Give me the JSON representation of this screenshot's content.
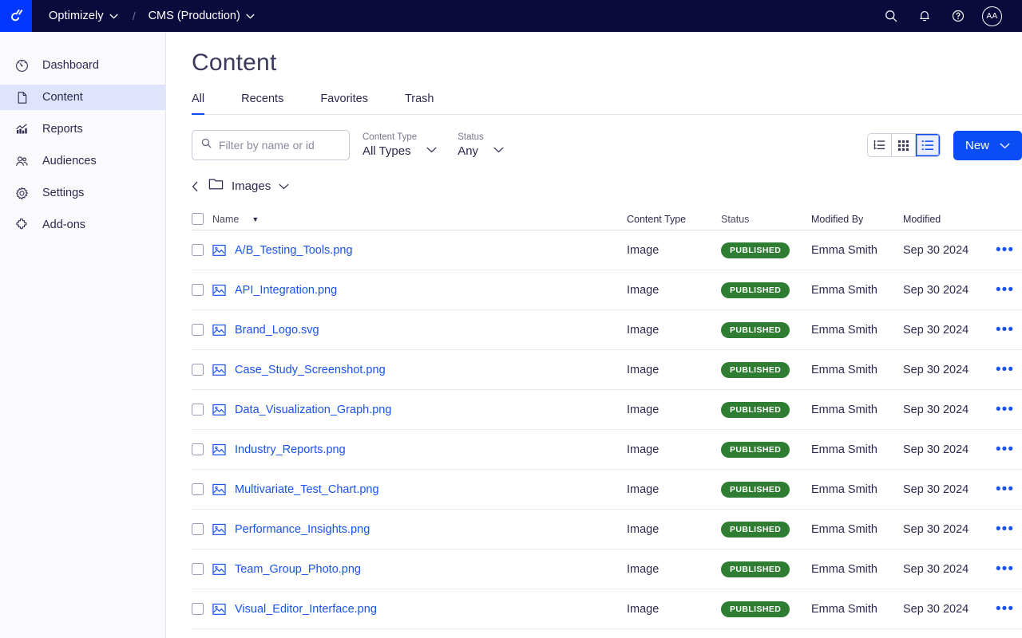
{
  "topbar": {
    "logo_icon": "optimizely-logo-icon",
    "brand": "Optimizely",
    "separator": "/",
    "environment": "CMS (Production)",
    "search_icon": "search-icon",
    "notifications_icon": "bell-icon",
    "help_icon": "help-circle-icon",
    "avatar_initials": "AA",
    "bg_color": "#0b0a3c",
    "logo_bg_color": "#0037ff"
  },
  "sidebar": {
    "items": [
      {
        "label": "Dashboard",
        "icon": "gauge-icon",
        "active": false
      },
      {
        "label": "Content",
        "icon": "document-icon",
        "active": true
      },
      {
        "label": "Reports",
        "icon": "chart-icon",
        "active": false
      },
      {
        "label": "Audiences",
        "icon": "people-icon",
        "active": false
      },
      {
        "label": "Settings",
        "icon": "gear-icon",
        "active": false
      },
      {
        "label": "Add-ons",
        "icon": "puzzle-icon",
        "active": false
      }
    ],
    "active_bg_color": "#dfe3fb"
  },
  "main": {
    "title": "Content",
    "tabs": [
      {
        "label": "All",
        "active": true
      },
      {
        "label": "Recents",
        "active": false
      },
      {
        "label": "Favorites",
        "active": false
      },
      {
        "label": "Trash",
        "active": false
      }
    ],
    "accent_color": "#0f4bf5",
    "search": {
      "value": "",
      "placeholder": "Filter by name or id",
      "icon": "search-icon"
    },
    "filters": [
      {
        "label": "Content Type",
        "value": "All Types",
        "icon": "chevron-down-icon"
      },
      {
        "label": "Status",
        "value": "Any",
        "icon": "chevron-down-icon"
      }
    ],
    "view_modes": [
      {
        "name": "tree-view",
        "icon": "tree-list-icon",
        "active": false
      },
      {
        "name": "grid-view",
        "icon": "grid-icon",
        "active": false
      },
      {
        "name": "list-view",
        "icon": "list-icon",
        "active": true
      }
    ],
    "new_button": {
      "label": "New",
      "icon": "chevron-down-icon",
      "color": "#0b4df5"
    },
    "breadcrumb": {
      "back_icon": "chevron-left-icon",
      "folder_icon": "folder-icon",
      "name": "Images",
      "chevron_icon": "chevron-down-icon"
    },
    "table": {
      "select_all_checked": false,
      "columns": [
        {
          "key": "name",
          "label": "Name",
          "sorted": true,
          "sort_icon": "sort-desc-arrow"
        },
        {
          "key": "content_type",
          "label": "Content Type"
        },
        {
          "key": "status",
          "label": "Status"
        },
        {
          "key": "modified_by",
          "label": "Modified By"
        },
        {
          "key": "modified",
          "label": "Modified"
        }
      ],
      "status_badge_color": "#2e7d32",
      "link_color": "#1a52f0",
      "rows": [
        {
          "name": "A/B_Testing_Tools.png",
          "icon": "image-file-icon",
          "content_type": "Image",
          "status": "PUBLISHED",
          "modified_by": "Emma Smith",
          "modified": "Sep 30 2024",
          "more": "more-options-icon"
        },
        {
          "name": "API_Integration.png",
          "icon": "image-file-icon",
          "content_type": "Image",
          "status": "PUBLISHED",
          "modified_by": "Emma Smith",
          "modified": "Sep 30 2024",
          "more": "more-options-icon"
        },
        {
          "name": "Brand_Logo.svg",
          "icon": "image-file-icon",
          "content_type": "Image",
          "status": "PUBLISHED",
          "modified_by": "Emma Smith",
          "modified": "Sep 30 2024",
          "more": "more-options-icon"
        },
        {
          "name": "Case_Study_Screenshot.png",
          "icon": "image-file-icon",
          "content_type": "Image",
          "status": "PUBLISHED",
          "modified_by": "Emma Smith",
          "modified": "Sep 30 2024",
          "more": "more-options-icon"
        },
        {
          "name": "Data_Visualization_Graph.png",
          "icon": "image-file-icon",
          "content_type": "Image",
          "status": "PUBLISHED",
          "modified_by": "Emma Smith",
          "modified": "Sep 30 2024",
          "more": "more-options-icon"
        },
        {
          "name": "Industry_Reports.png",
          "icon": "image-file-icon",
          "content_type": "Image",
          "status": "PUBLISHED",
          "modified_by": "Emma Smith",
          "modified": "Sep 30 2024",
          "more": "more-options-icon"
        },
        {
          "name": "Multivariate_Test_Chart.png",
          "icon": "image-file-icon",
          "content_type": "Image",
          "status": "PUBLISHED",
          "modified_by": "Emma Smith",
          "modified": "Sep 30 2024",
          "more": "more-options-icon"
        },
        {
          "name": "Performance_Insights.png",
          "icon": "image-file-icon",
          "content_type": "Image",
          "status": "PUBLISHED",
          "modified_by": "Emma Smith",
          "modified": "Sep 30 2024",
          "more": "more-options-icon"
        },
        {
          "name": "Team_Group_Photo.png",
          "icon": "image-file-icon",
          "content_type": "Image",
          "status": "PUBLISHED",
          "modified_by": "Emma Smith",
          "modified": "Sep 30 2024",
          "more": "more-options-icon"
        },
        {
          "name": "Visual_Editor_Interface.png",
          "icon": "image-file-icon",
          "content_type": "Image",
          "status": "PUBLISHED",
          "modified_by": "Emma Smith",
          "modified": "Sep 30 2024",
          "more": "more-options-icon"
        }
      ]
    }
  }
}
